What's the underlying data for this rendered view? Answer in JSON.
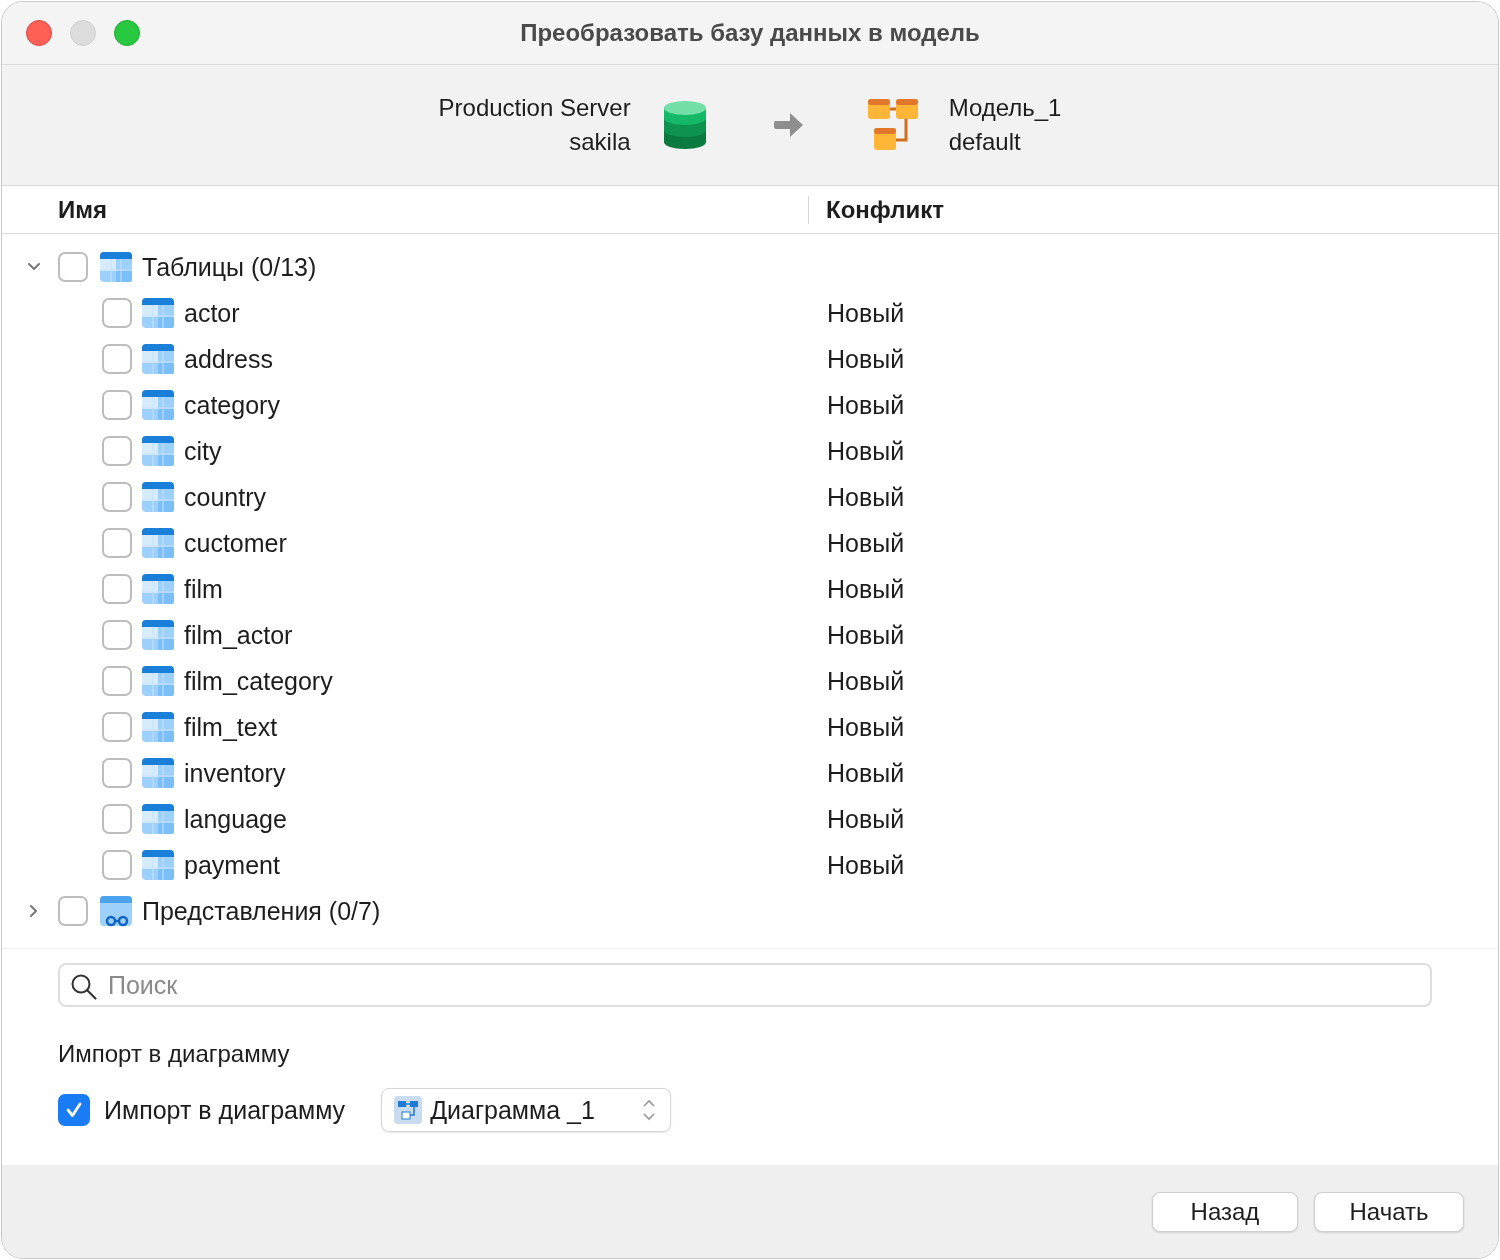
{
  "window": {
    "title": "Преобразовать базу данных в модель"
  },
  "source": {
    "server": "Production Server",
    "database": "sakila"
  },
  "target": {
    "model": "Модель_1",
    "schema": "default"
  },
  "columns": [
    "Имя",
    "Конфликт"
  ],
  "groups": [
    {
      "kind": "tables",
      "label": "Таблицы (0/13)",
      "expanded": true,
      "checked": false,
      "children": [
        {
          "name": "actor",
          "conflict": "Новый",
          "checked": false
        },
        {
          "name": "address",
          "conflict": "Новый",
          "checked": false
        },
        {
          "name": "category",
          "conflict": "Новый",
          "checked": false
        },
        {
          "name": "city",
          "conflict": "Новый",
          "checked": false
        },
        {
          "name": "country",
          "conflict": "Новый",
          "checked": false
        },
        {
          "name": "cuctomer",
          "conflict": "Новый",
          "checked": false
        },
        {
          "name": "film",
          "conflict": "Новый",
          "checked": false
        },
        {
          "name": "film_actor",
          "conflict": "Новый",
          "checked": false
        },
        {
          "name": "film_category",
          "conflict": "Новый",
          "checked": false
        },
        {
          "name": "film_text",
          "conflict": "Новый",
          "checked": false
        },
        {
          "name": "inventory",
          "conflict": "Новый",
          "checked": false
        },
        {
          "name": "language",
          "conflict": "Новый",
          "checked": false
        },
        {
          "name": "payment",
          "conflict": "Новый",
          "checked": false
        }
      ]
    },
    {
      "kind": "views",
      "label": "Представления (0/7)",
      "expanded": false,
      "checked": false
    }
  ],
  "search": {
    "placeholder": "Поиск"
  },
  "import": {
    "heading": "Импорт в диаграмму",
    "label": "Импорт в диаграмму",
    "checked": true,
    "diagram": "Диаграмма _1"
  },
  "buttons": [
    "Назад",
    "Начать"
  ]
}
